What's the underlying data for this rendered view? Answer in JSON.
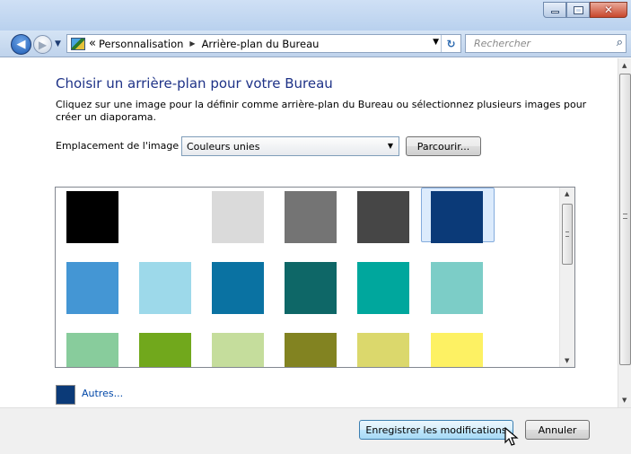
{
  "window": {
    "buttons": {
      "minimize": "minimize",
      "maximize": "maximize",
      "close": "✕"
    }
  },
  "nav": {
    "breadcrumb_chevron": "«",
    "breadcrumb": [
      "Personnalisation",
      "Arrière-plan du Bureau"
    ],
    "search_placeholder": "Rechercher"
  },
  "main": {
    "heading": "Choisir un arrière-plan pour votre Bureau",
    "description": "Cliquez sur une image pour la définir comme arrière-plan du Bureau ou sélectionnez plusieurs images pour créer un diaporama.",
    "location_label": "Emplacement de l'image :",
    "location_value": "Couleurs unies",
    "browse_label": "Parcourir...",
    "swatches": [
      [
        "#000000",
        "#ffffff",
        "#dadada",
        "#747474",
        "#464646",
        "#0b3a78"
      ],
      [
        "#4496d4",
        "#9dd9ea",
        "#0a72a2",
        "#0e6767",
        "#00a79d",
        "#7ccdc7"
      ],
      [
        "#88cc9c",
        "#71a81c",
        "#c5dd9c",
        "#828321",
        "#dbd86c",
        "#fdf163"
      ]
    ],
    "selected_swatch": "#0b3a78",
    "other_color": "#0b3a78",
    "other_label": "Autres..."
  },
  "footer": {
    "save_label": "Enregistrer les modifications",
    "cancel_label": "Annuler"
  }
}
